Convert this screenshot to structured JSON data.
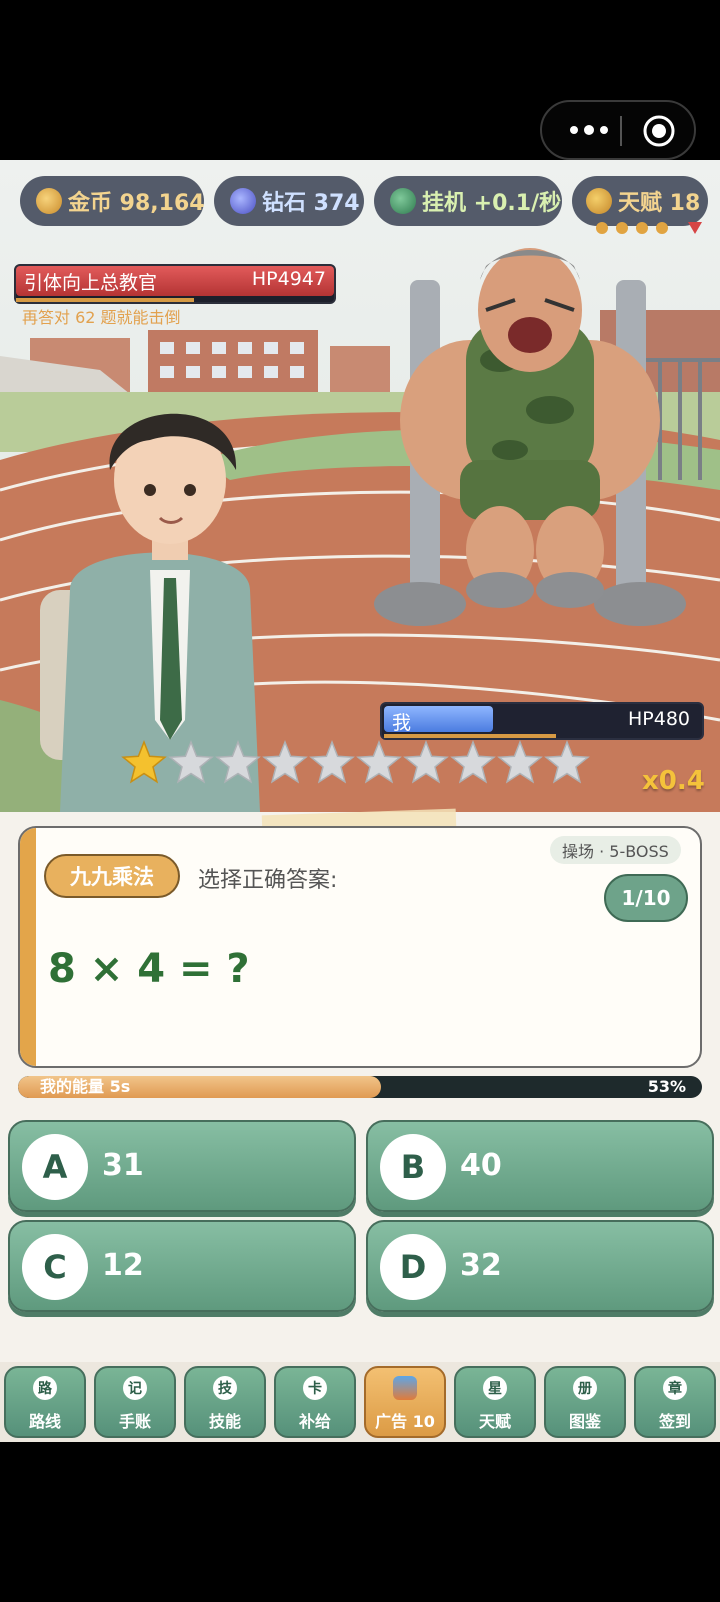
{
  "capsule": {
    "menu_icon": "more-dots-icon",
    "close_icon": "target-circle-icon"
  },
  "resources": {
    "gold": {
      "label": "金币 98,164",
      "icon": "coin-icon"
    },
    "diamond": {
      "label": "钻石 374",
      "icon": "diamond-icon"
    },
    "idle": {
      "label": "挂机 +0.1/秒",
      "icon": "clover-icon"
    },
    "talent": {
      "label": "天赋 18",
      "icon": "star-badge-icon"
    }
  },
  "boss": {
    "name": "引体向上总教官",
    "hp": "HP4947",
    "hp_fraction": 1.0,
    "hint": "再答对 62 题就能击倒"
  },
  "player": {
    "name": "我",
    "hp": "HP480",
    "hp_fraction": 0.34
  },
  "stars": {
    "filled": 1,
    "total": 10
  },
  "multiplier": "x0.4",
  "quiz": {
    "category": "九九乘法",
    "prompt": "选择正确答案:",
    "stage": "操场 · 5-BOSS",
    "counter": "1/10",
    "question": "8 × 4 = ?"
  },
  "energy": {
    "label": "我的能量  5s",
    "percent_text": "53%",
    "percent": 53
  },
  "options": [
    {
      "letter": "A",
      "value": "31"
    },
    {
      "letter": "B",
      "value": "40"
    },
    {
      "letter": "C",
      "value": "12"
    },
    {
      "letter": "D",
      "value": "32"
    }
  ],
  "nav": [
    {
      "icon_char": "路",
      "label": "路线"
    },
    {
      "icon_char": "记",
      "label": "手账"
    },
    {
      "icon_char": "技",
      "label": "技能"
    },
    {
      "icon_char": "卡",
      "label": "补给"
    },
    {
      "icon_char": "",
      "label": "广告 10"
    },
    {
      "icon_char": "星",
      "label": "天赋"
    },
    {
      "icon_char": "册",
      "label": "图鉴"
    },
    {
      "icon_char": "章",
      "label": "签到"
    }
  ],
  "colors": {
    "accent_green": "#5f9a7e",
    "boss_red": "#c84444",
    "player_blue": "#6f98ee",
    "gold": "#f3d48f"
  }
}
